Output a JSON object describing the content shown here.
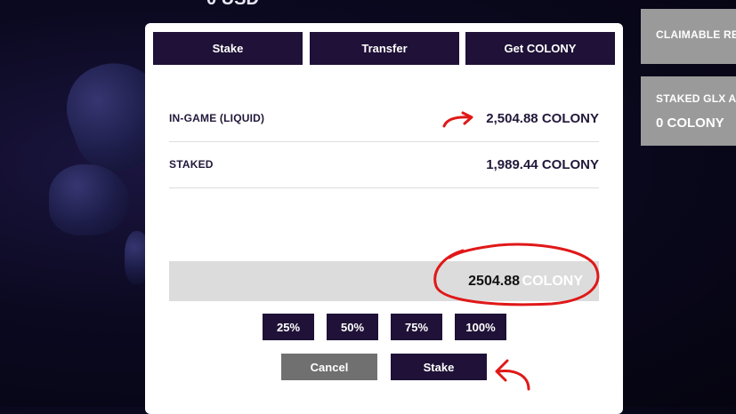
{
  "background": {
    "top_text": "0 USD"
  },
  "side_cards": [
    {
      "label": "CLAIMABLE REW",
      "value": ""
    },
    {
      "label": "STAKED GLX AN",
      "value": "0 COLONY"
    }
  ],
  "modal": {
    "tabs": [
      {
        "label": "Stake"
      },
      {
        "label": "Transfer"
      },
      {
        "label": "Get COLONY"
      }
    ],
    "balances": {
      "in_game_label": "IN-GAME (LIQUID)",
      "in_game_value": "2,504.88 COLONY",
      "staked_label": "STAKED",
      "staked_value": "1,989.44 COLONY"
    },
    "amount_input": {
      "value": "2504.88",
      "unit": "COLONY"
    },
    "percent_buttons": [
      "25%",
      "50%",
      "75%",
      "100%"
    ],
    "cancel_label": "Cancel",
    "stake_label": "Stake"
  },
  "colors": {
    "dark_purple": "#1f1137",
    "annotation_red": "#e01818",
    "cancel_gray": "#707070"
  }
}
